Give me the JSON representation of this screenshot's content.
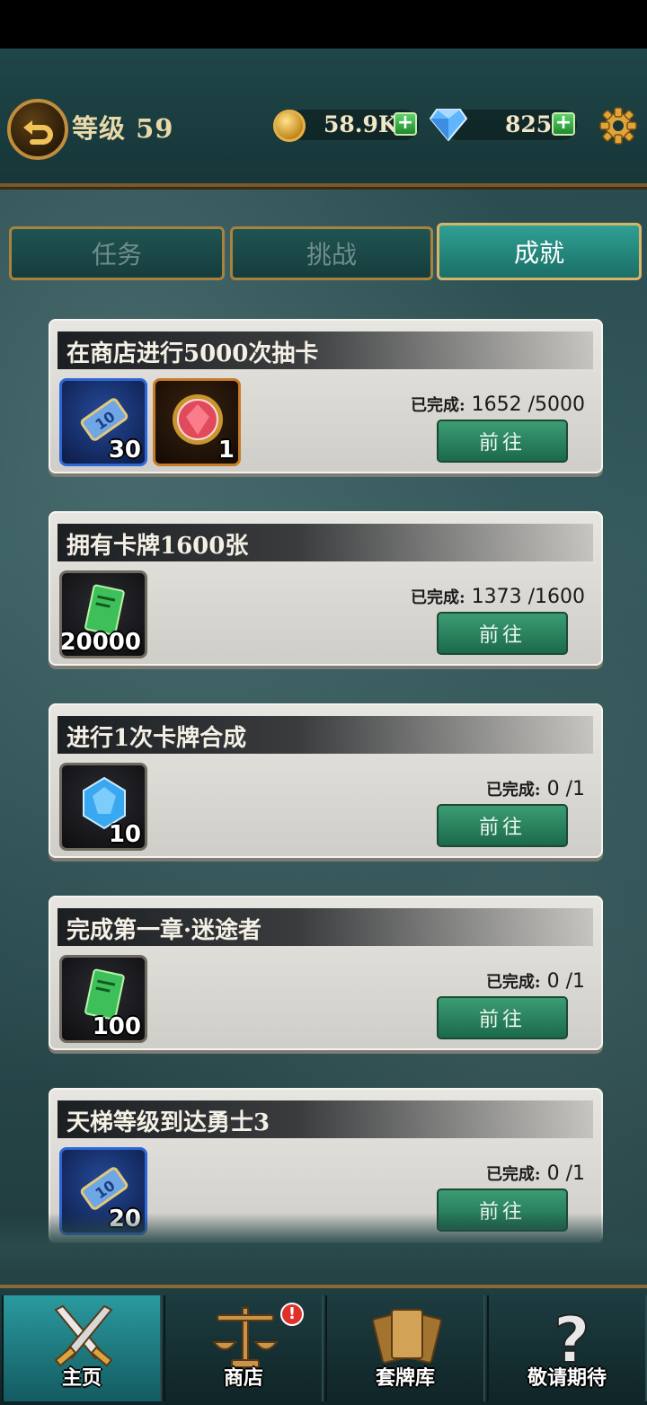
{
  "header": {
    "level_label": "等级 59",
    "coins": "58.9K",
    "gems": "825",
    "plus": "+"
  },
  "tabs": [
    {
      "label": "任务",
      "active": false
    },
    {
      "label": "挑战",
      "active": false
    },
    {
      "label": "成就",
      "active": true
    }
  ],
  "achievements": [
    {
      "title": "在商店进行5000次抽卡",
      "rewards": [
        {
          "icon": "ticket-10-icon",
          "qty": "30",
          "frame": "blue"
        },
        {
          "icon": "red-gem-icon",
          "qty": "1",
          "frame": "orange"
        }
      ],
      "progress_label": "已完成:",
      "progress": "1652 /5000",
      "button": "前往"
    },
    {
      "title": "拥有卡牌1600张",
      "rewards": [
        {
          "icon": "green-card-icon",
          "qty": "20000",
          "frame": "dark"
        }
      ],
      "progress_label": "已完成:",
      "progress": "1373 /1600",
      "button": "前往"
    },
    {
      "title": "进行1次卡牌合成",
      "rewards": [
        {
          "icon": "blue-crystal-icon",
          "qty": "10",
          "frame": "dark"
        }
      ],
      "progress_label": "已完成:",
      "progress": "0 /1",
      "button": "前往"
    },
    {
      "title": "完成第一章·迷途者",
      "rewards": [
        {
          "icon": "green-card-icon",
          "qty": "100",
          "frame": "dark"
        }
      ],
      "progress_label": "已完成:",
      "progress": "0 /1",
      "button": "前往"
    },
    {
      "title": "天梯等级到达勇士3",
      "rewards": [
        {
          "icon": "ticket-10-icon",
          "qty": "20",
          "frame": "blue"
        }
      ],
      "progress_label": "已完成:",
      "progress": "0 /1",
      "button": "前往"
    }
  ],
  "nav": [
    {
      "label": "主页",
      "icon": "crossed-swords-icon",
      "active": true
    },
    {
      "label": "商店",
      "icon": "scales-icon",
      "active": false,
      "badge": "!"
    },
    {
      "label": "套牌库",
      "icon": "card-deck-icon",
      "active": false
    },
    {
      "label": "敬请期待",
      "icon": "question-mark-icon",
      "active": false
    }
  ],
  "colors": {
    "accent_green": "#1b6a4a",
    "tab_active": "#2fa093",
    "gold_border": "#a8823f"
  }
}
